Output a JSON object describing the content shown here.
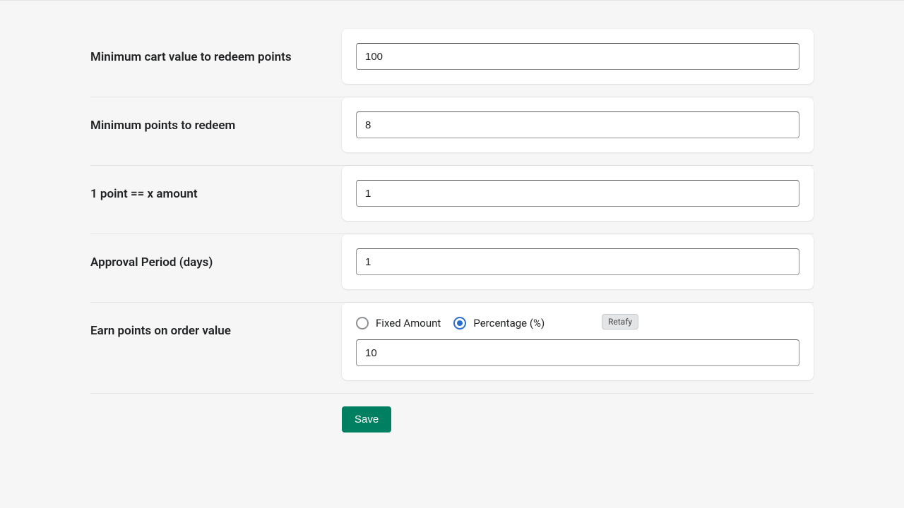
{
  "fields": {
    "min_cart": {
      "label": "Minimum cart value to redeem points",
      "value": "100"
    },
    "min_points": {
      "label": "Minimum points to redeem",
      "value": "8"
    },
    "point_amount": {
      "label": "1 point == x amount",
      "value": "1"
    },
    "approval": {
      "label": "Approval Period (days)",
      "value": "1"
    },
    "earn": {
      "label": "Earn points on order value",
      "fixed_label": "Fixed Amount",
      "percent_label": "Percentage (%)",
      "selected": "percent",
      "value": "10",
      "tooltip": "Retafy"
    }
  },
  "actions": {
    "save": "Save"
  }
}
